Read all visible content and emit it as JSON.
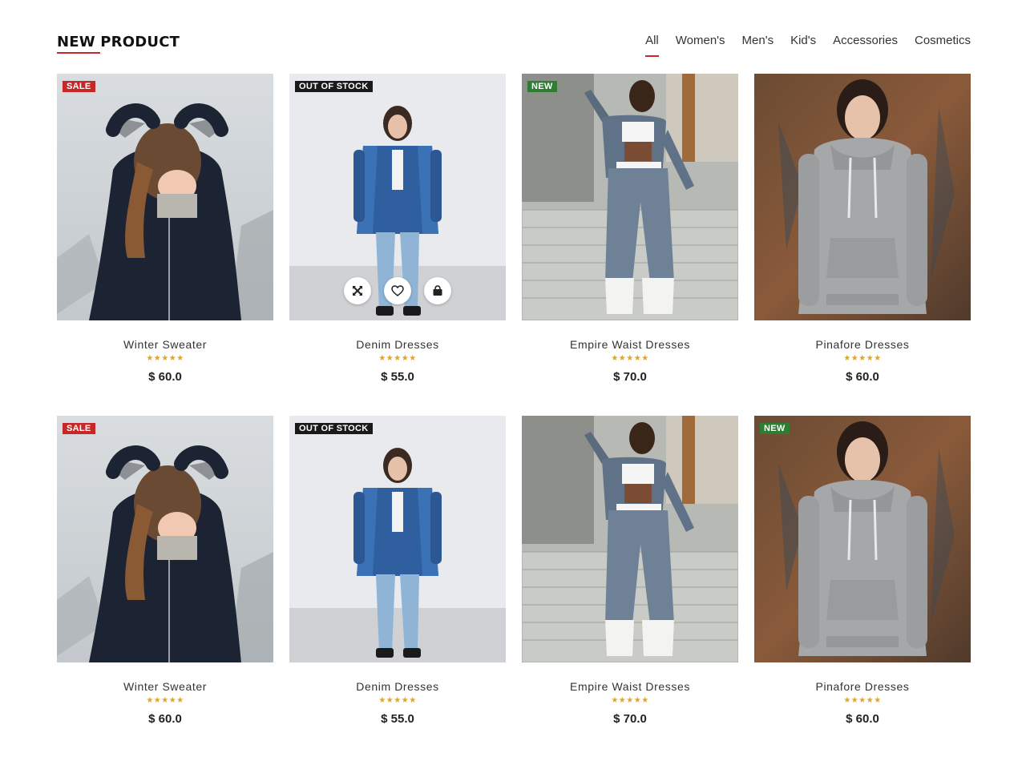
{
  "header": {
    "title": "NEW PRODUCT",
    "filters": [
      "All",
      "Women's",
      "Men's",
      "Kid's",
      "Accessories",
      "Cosmetics"
    ],
    "active_filter": "All"
  },
  "colors": {
    "accent": "#c62828",
    "sale": "#c62828",
    "out_of_stock": "#1a1a1a",
    "new": "#2e7d32",
    "stars": "#e0a526"
  },
  "products": [
    {
      "name": "Winter Sweater",
      "price": "$ 60.0",
      "badge": "SALE",
      "rating": "★★★★★",
      "scene": "sweater"
    },
    {
      "name": "Denim Dresses",
      "price": "$ 55.0",
      "badge": "OUT OF STOCK",
      "rating": "★★★★★",
      "scene": "denim",
      "actions": [
        "expand-icon",
        "heart-icon",
        "bag-icon"
      ]
    },
    {
      "name": "Empire Waist Dresses",
      "price": "$ 70.0",
      "badge": "NEW",
      "rating": "★★★★★",
      "scene": "empire"
    },
    {
      "name": "Pinafore Dresses",
      "price": "$ 60.0",
      "badge": "",
      "rating": "★★★★★",
      "scene": "hoodie"
    },
    {
      "name": "Winter Sweater",
      "price": "$ 60.0",
      "badge": "SALE",
      "rating": "★★★★★",
      "scene": "sweater"
    },
    {
      "name": "Denim Dresses",
      "price": "$ 55.0",
      "badge": "OUT OF STOCK",
      "rating": "★★★★★",
      "scene": "denim"
    },
    {
      "name": "Empire Waist Dresses",
      "price": "$ 70.0",
      "badge": "",
      "rating": "★★★★★",
      "scene": "empire"
    },
    {
      "name": "Pinafore Dresses",
      "price": "$ 60.0",
      "badge": "NEW",
      "rating": "★★★★★",
      "scene": "hoodie"
    }
  ]
}
